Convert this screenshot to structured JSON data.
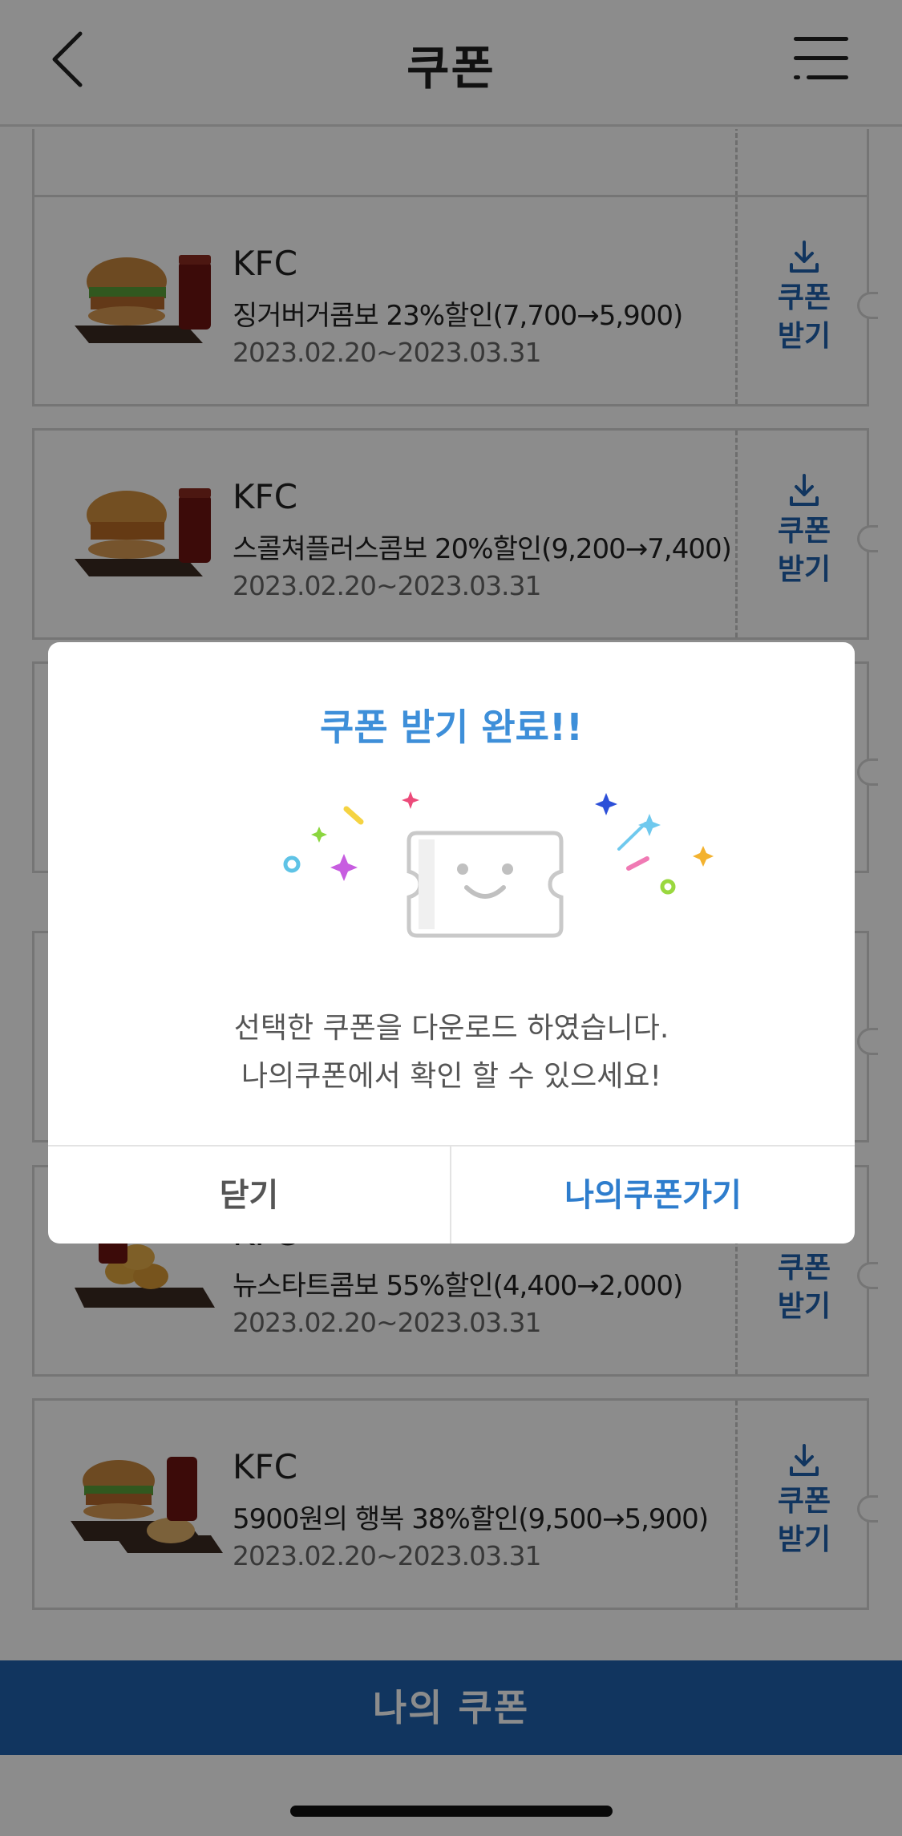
{
  "header": {
    "title": "쿠폰",
    "back_icon": "chevron-left-icon",
    "menu_icon": "hamburger-menu-icon"
  },
  "coupons": [
    {
      "brand": "KFC",
      "name": "징거버거콤보 23%할인(7,700→5,900)",
      "period": "2023.02.20~2023.03.31",
      "action": "쿠폰 받기"
    },
    {
      "brand": "KFC",
      "name": "스콜쳐플러스콤보 20%할인(9,200→7,400)",
      "period": "2023.02.20~2023.03.31",
      "action": "쿠폰 받기"
    },
    {
      "brand": "KFC",
      "name": "뉴스타트콤보 55%할인(4,400→2,000)",
      "period": "2023.02.20~2023.03.31",
      "action": "쿠폰 받기"
    },
    {
      "brand": "KFC",
      "name": "5900원의 행복 38%할인(9,500→5,900)",
      "period": "2023.02.20~2023.03.31",
      "action": "쿠폰 받기"
    }
  ],
  "bottom_bar": {
    "label": "나의 쿠폰"
  },
  "modal": {
    "title": "쿠폰 받기 완료!!",
    "message_line1": "선택한 쿠폰을 다운로드 하였습니다.",
    "message_line2": "나의쿠폰에서 확인 할 수 있으세요!",
    "close_label": "닫기",
    "go_label": "나의쿠폰가기",
    "illustration_icon": "smiling-ticket-icon"
  },
  "colors": {
    "primary": "#1f62ad",
    "modal_title": "#3e8fd9",
    "accent_link": "#2e7dcd"
  }
}
